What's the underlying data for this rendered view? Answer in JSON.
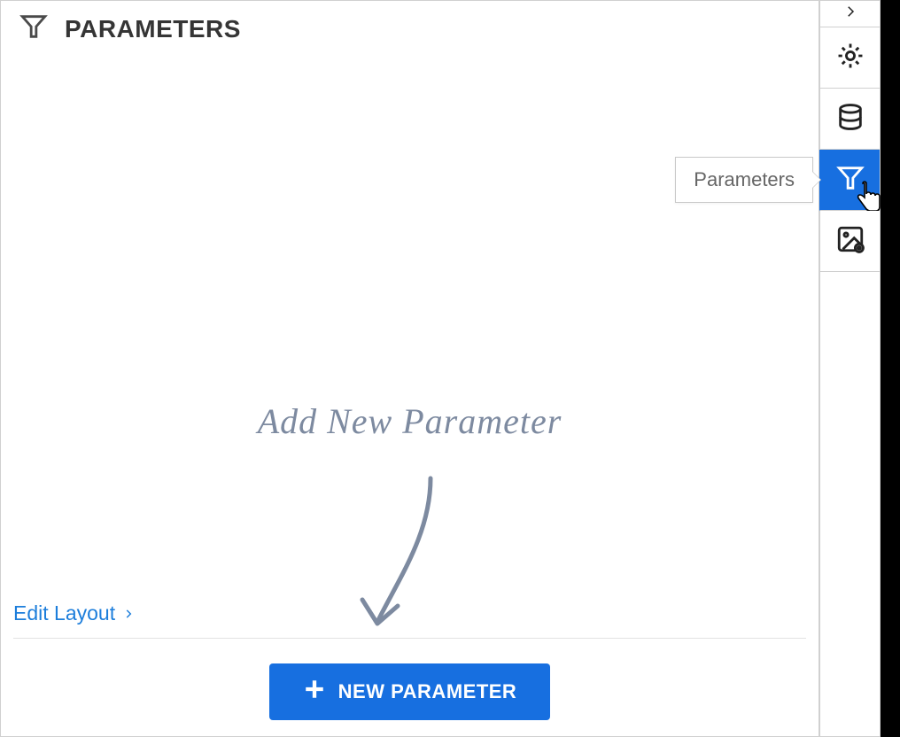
{
  "header": {
    "title": "PARAMETERS"
  },
  "hint": {
    "text": "Add New Parameter"
  },
  "footer": {
    "edit_layout_label": "Edit Layout",
    "new_parameter_label": "NEW PARAMETER"
  },
  "sidebar": {
    "expand": {
      "name": "expand"
    },
    "settings": {
      "name": "settings"
    },
    "data": {
      "name": "data"
    },
    "parameters": {
      "name": "parameters",
      "tooltip": "Parameters",
      "active": true
    },
    "image_settings": {
      "name": "image-settings"
    }
  }
}
